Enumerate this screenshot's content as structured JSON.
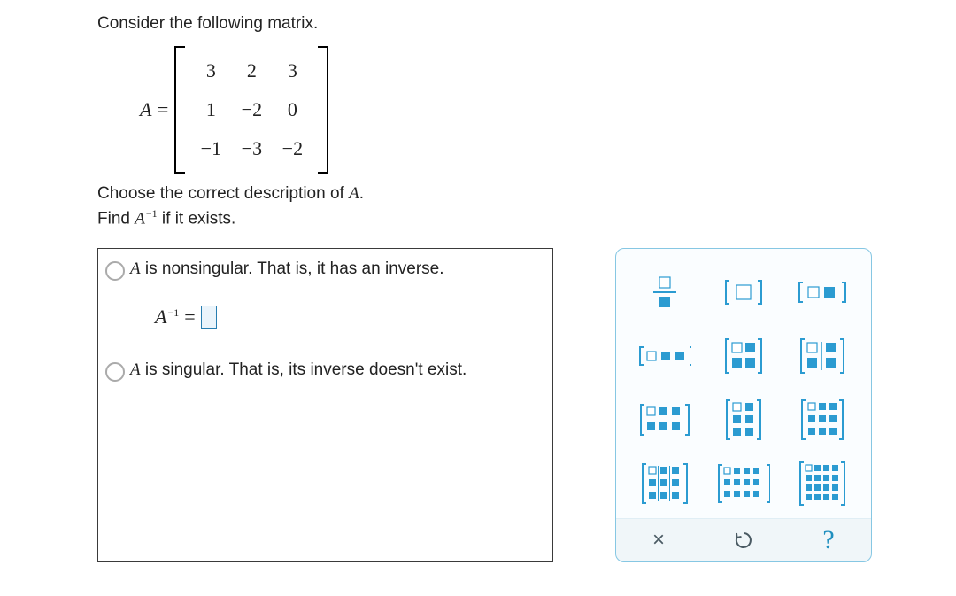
{
  "prompt": "Consider the following matrix.",
  "matrix": {
    "lhs": "A =",
    "rows": [
      [
        "3",
        "2",
        "3"
      ],
      [
        "1",
        "−2",
        "0"
      ],
      [
        "−1",
        "−3",
        "−2"
      ]
    ]
  },
  "question": {
    "line1_pre": "Choose the correct description of ",
    "line1_A": "A",
    "line1_post": ".",
    "line2_pre": "Find ",
    "line2_A": "A",
    "line2_sup": "−1",
    "line2_post": " if it exists."
  },
  "choices": {
    "opt1_pre": "A",
    "opt1_post": " is nonsingular. That is, it has an inverse.",
    "eq_A": "A",
    "eq_sup": "−1",
    "eq_eq": "=",
    "opt2_pre": "A",
    "opt2_post": " is singular. That is, its inverse doesn't exist."
  },
  "palette": {
    "items": [
      "fraction",
      "matrix-1x1",
      "matrix-1x2",
      "matrix-1x3",
      "matrix-2x2",
      "matrix-2x2-split",
      "matrix-2x3",
      "matrix-3x2",
      "matrix-3x3",
      "matrix-3x3-grid",
      "matrix-3x4",
      "matrix-4x4"
    ]
  },
  "toolbar": {
    "close": "×",
    "undo": "↻",
    "help": "?"
  }
}
